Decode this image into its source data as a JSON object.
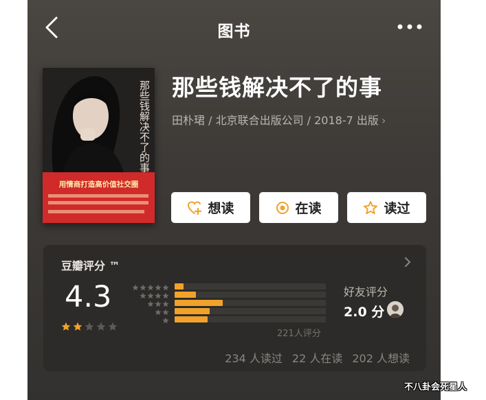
{
  "nav": {
    "title": "图书",
    "back_icon": "back-chevron-icon",
    "more_icon": "more-dots-icon"
  },
  "book": {
    "title": "那些钱解决不了的事",
    "meta": "田朴珺 / 北京联合出版公司 / 2018-7 出版",
    "meta_chevron": "›",
    "cover": {
      "title": "那些钱解决不了的事",
      "slogan": "用情商打造高价值社交圈"
    }
  },
  "actions": {
    "want": {
      "label": "想读",
      "icon": "add-heart-icon"
    },
    "reading": {
      "label": "在读",
      "icon": "target-circle-icon"
    },
    "read": {
      "label": "读过",
      "icon": "star-outline-icon"
    }
  },
  "rating": {
    "title": "豆瓣评分 ™",
    "score": "4.3",
    "stars_filled": 2,
    "stars_total": 5,
    "distribution": [
      {
        "stars": 5,
        "fraction": 0.06
      },
      {
        "stars": 4,
        "fraction": 0.14
      },
      {
        "stars": 3,
        "fraction": 0.32
      },
      {
        "stars": 2,
        "fraction": 0.23
      },
      {
        "stars": 1,
        "fraction": 0.22
      }
    ],
    "count_label": "221人评分",
    "friends": {
      "label": "好友评分",
      "score": "2.0 分"
    },
    "counts": {
      "read": "234 人读过",
      "reading": "22 人在读",
      "want": "202 人想读"
    }
  },
  "colors": {
    "accent": "#f1a22b",
    "card": "#2c2b29",
    "cover_band": "#d02a2a"
  },
  "watermark": "不八卦会死星人"
}
